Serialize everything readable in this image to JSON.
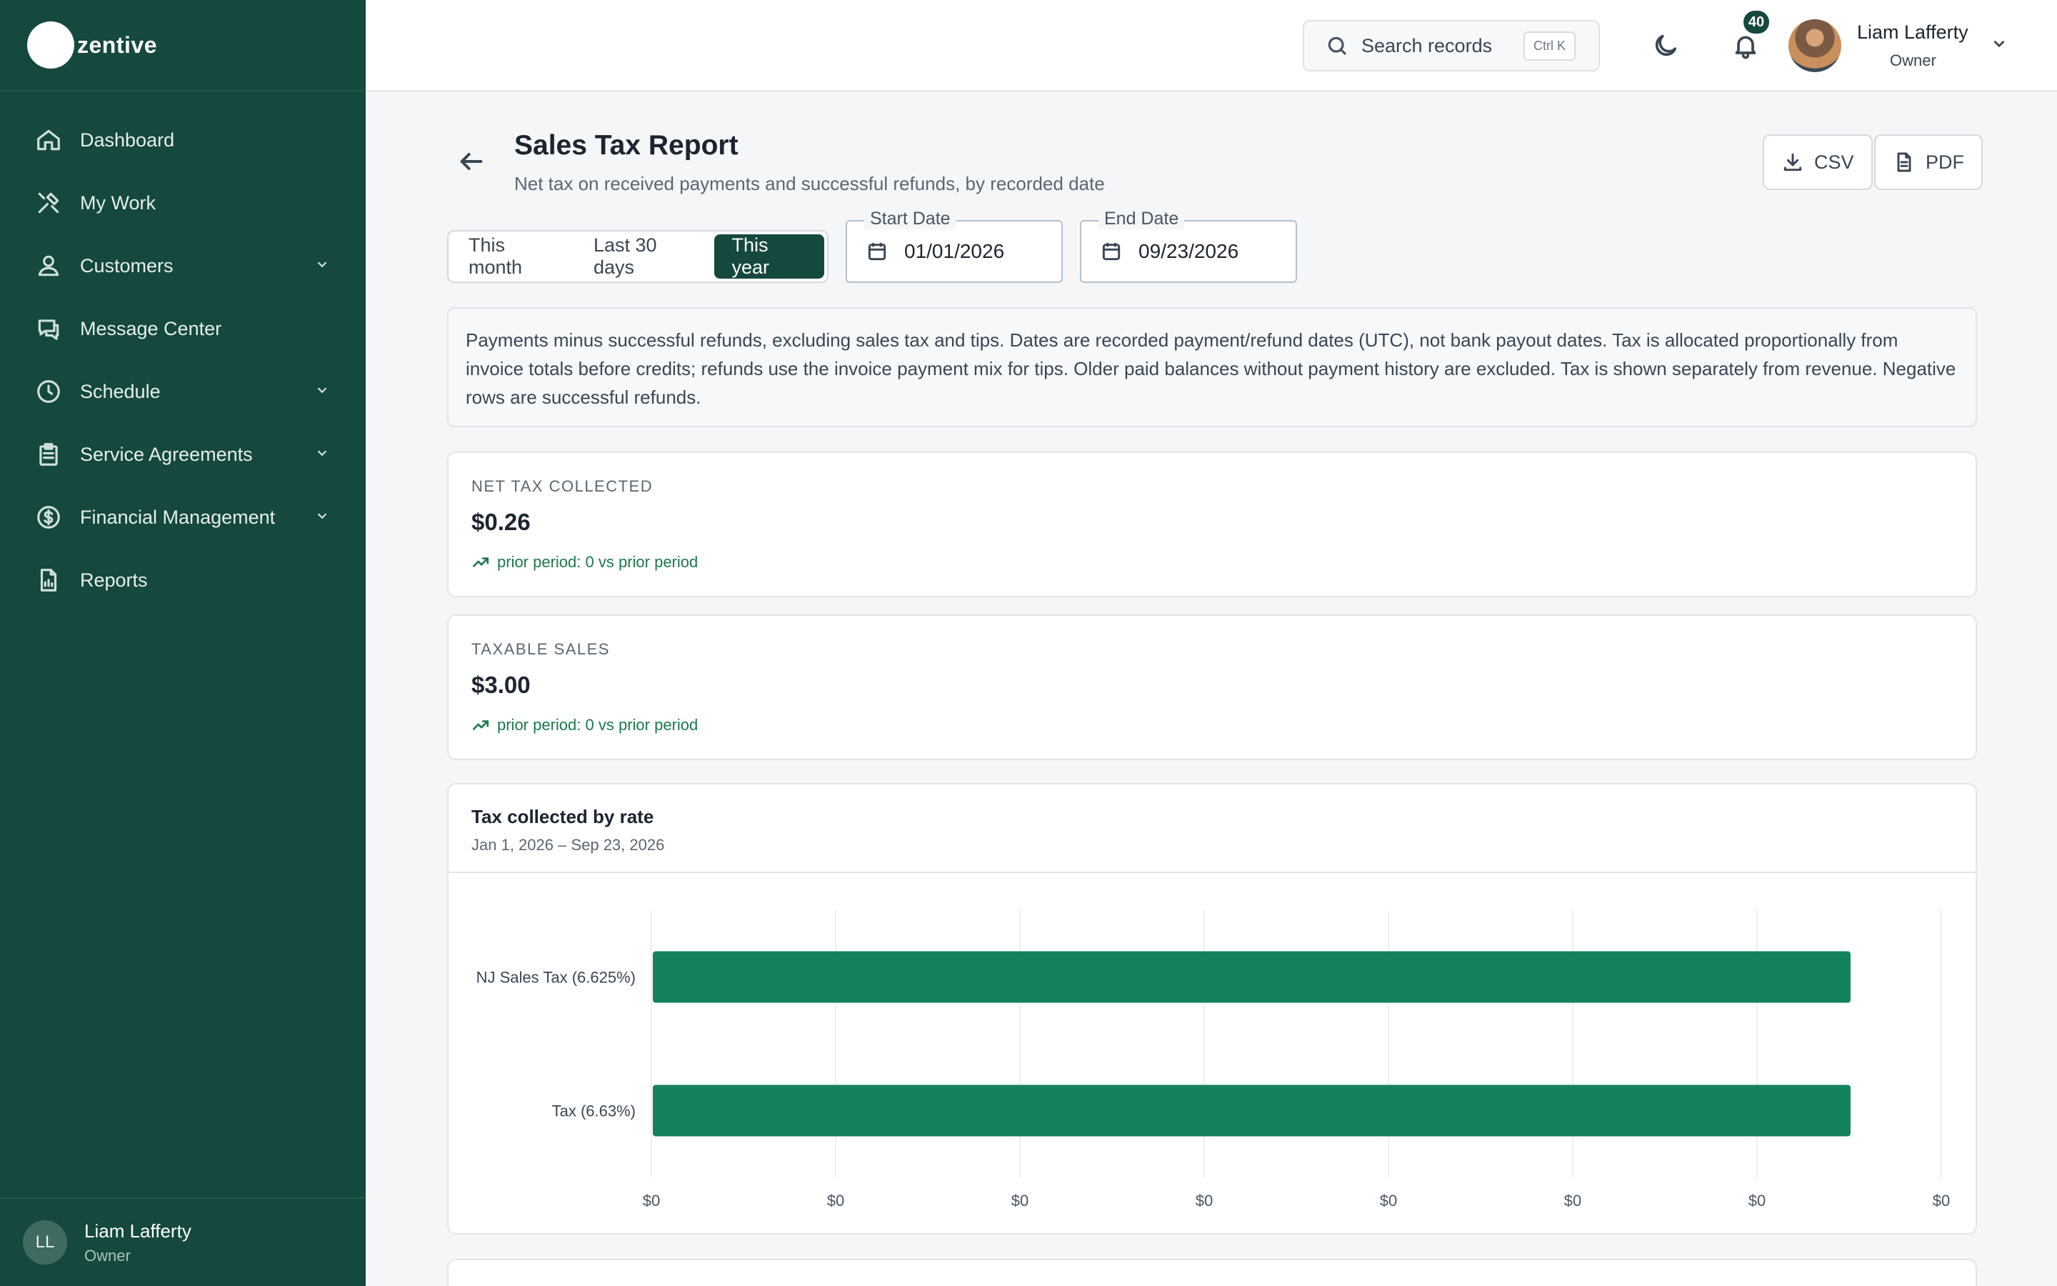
{
  "brand": {
    "name": "zentive"
  },
  "sidebar": {
    "items": [
      {
        "label": "Dashboard",
        "icon": "home-icon",
        "chevron": false
      },
      {
        "label": "My Work",
        "icon": "tools-icon",
        "chevron": false
      },
      {
        "label": "Customers",
        "icon": "users-icon",
        "chevron": true
      },
      {
        "label": "Message Center",
        "icon": "chat-icon",
        "chevron": false
      },
      {
        "label": "Schedule",
        "icon": "clock-icon",
        "chevron": true
      },
      {
        "label": "Service Agreements",
        "icon": "clipboard-icon",
        "chevron": true
      },
      {
        "label": "Financial Management",
        "icon": "dollar-circle-icon",
        "chevron": true
      },
      {
        "label": "Reports",
        "icon": "report-icon",
        "chevron": false
      }
    ],
    "user": {
      "initials": "LL",
      "name": "Liam Lafferty",
      "role": "Owner"
    }
  },
  "header": {
    "search_placeholder": "Search records",
    "search_shortcut": "Ctrl K",
    "notification_count": "40",
    "user_name": "Liam Lafferty",
    "user_role": "Owner"
  },
  "page": {
    "title": "Sales Tax Report",
    "subtitle": "Net tax on received payments and successful refunds, by recorded date",
    "csv_label": "CSV",
    "pdf_label": "PDF",
    "ranges": [
      "This month",
      "Last 30 days",
      "This year"
    ],
    "active_range": "This year",
    "start_date_label": "Start Date",
    "start_date": "01/01/2026",
    "end_date_label": "End Date",
    "end_date": "09/23/2026",
    "note": "Payments minus successful refunds, excluding sales tax and tips. Dates are recorded payment/refund dates (UTC), not bank payout dates. Tax is allocated proportionally from invoice totals before credits; refunds use the invoice payment mix for tips. Older paid balances without payment history are excluded. Tax is shown separately from revenue. Negative rows are successful refunds."
  },
  "kpis": [
    {
      "label": "NET TAX COLLECTED",
      "value": "$0.26",
      "delta": "prior period: 0 vs prior period"
    },
    {
      "label": "TAXABLE SALES",
      "value": "$3.00",
      "delta": "prior period: 0 vs prior period"
    }
  ],
  "chart": {
    "title": "Tax collected by rate",
    "subtitle": "Jan 1, 2026 – Sep 23, 2026"
  },
  "colors": {
    "brand": "#15483e",
    "bar": "#15825e",
    "positive": "#1b7a4a"
  },
  "chart_data": {
    "type": "bar",
    "orientation": "horizontal",
    "categories": [
      "NJ Sales Tax (6.625%)",
      "Tax (6.63%)"
    ],
    "values": [
      0.13,
      0.13
    ],
    "xlim": [
      0,
      0.14
    ],
    "x_tick_labels": [
      "$0",
      "$0",
      "$0",
      "$0",
      "$0",
      "$0",
      "$0",
      "$0"
    ],
    "grid": true
  }
}
